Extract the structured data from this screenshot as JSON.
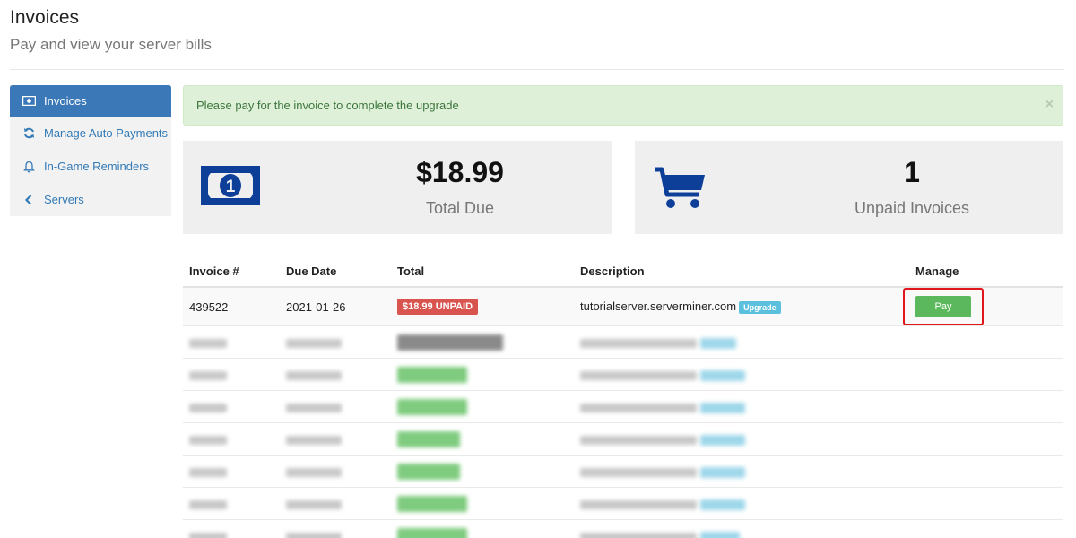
{
  "header": {
    "title": "Invoices",
    "subtitle": "Pay and view your server bills"
  },
  "sidebar": {
    "items": [
      {
        "label": "Invoices",
        "icon": "money-icon",
        "active": true
      },
      {
        "label": "Manage Auto Payments",
        "icon": "refresh-icon"
      },
      {
        "label": "In-Game Reminders",
        "icon": "bell-icon"
      },
      {
        "label": "Servers",
        "icon": "chevron-left-icon"
      }
    ]
  },
  "alert": {
    "message": "Please pay for the invoice to complete the upgrade",
    "close": "×"
  },
  "stats": {
    "total_due": {
      "value": "$18.99",
      "label": "Total Due",
      "icon": "money-icon"
    },
    "unpaid": {
      "value": "1",
      "label": "Unpaid Invoices",
      "icon": "cart-icon"
    }
  },
  "table": {
    "headers": [
      "Invoice #",
      "Due Date",
      "Total",
      "Description",
      "Manage"
    ],
    "first_row": {
      "invoice": "439522",
      "due_date": "2021-01-26",
      "total": "$18.99 UNPAID",
      "description": "tutorialserver.serverminer.com",
      "tag": "Upgrade",
      "action": "Pay"
    }
  },
  "colors": {
    "primary": "#3a78b7",
    "success": "#5cb85c",
    "danger": "#d9534f",
    "info": "#5bc0de",
    "icon_blue": "#0d3f99"
  }
}
